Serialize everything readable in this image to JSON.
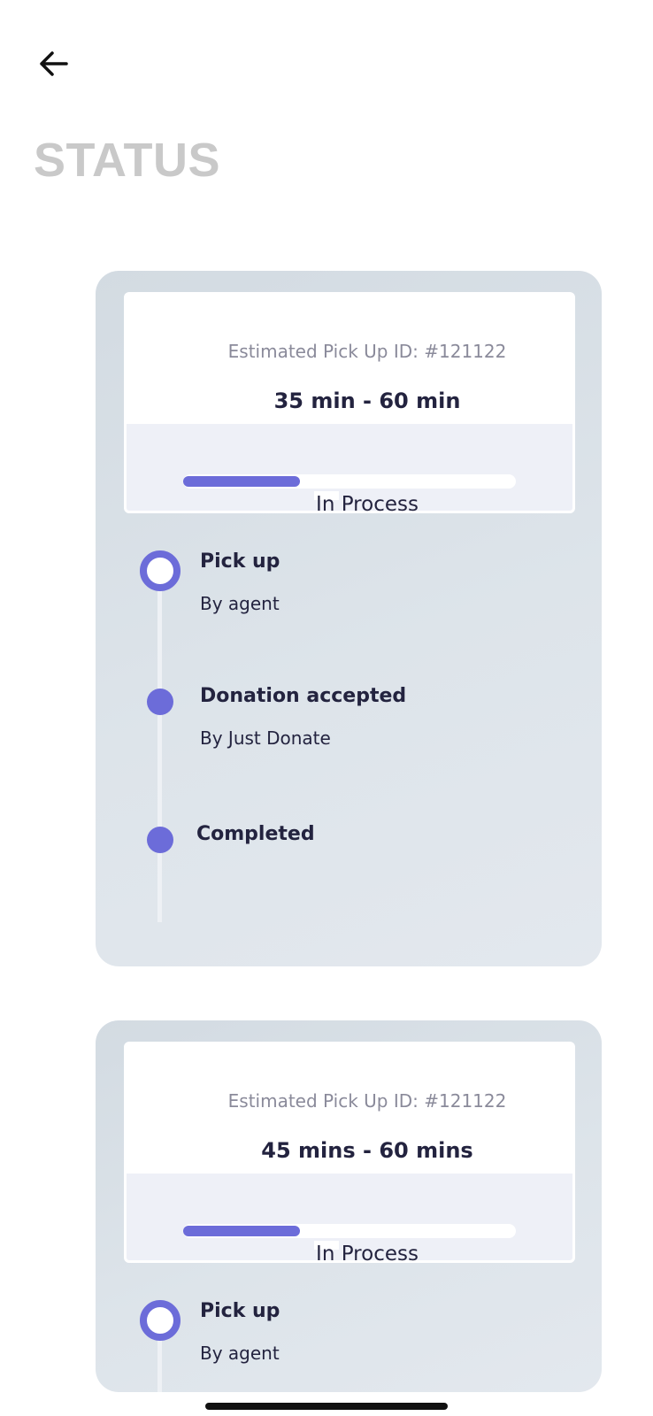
{
  "header": {
    "back_icon": "arrow-left-icon",
    "title": "STATUS"
  },
  "colors": {
    "accent": "#6c6cd9",
    "title_gray": "#c9c9c9",
    "card_bg": "#d9e0e6"
  },
  "orders": [
    {
      "estimate_label": "Estimated Pick Up ID: #121122",
      "estimate_time": "35 min - 60 min",
      "progress": 0.35,
      "status": "In Process",
      "steps": [
        {
          "title": "Pick up",
          "subtitle": "By agent",
          "state": "current"
        },
        {
          "title": "Donation accepted",
          "subtitle": "By Just Donate",
          "state": "pending"
        },
        {
          "title": "Completed",
          "subtitle": "",
          "state": "pending"
        }
      ]
    },
    {
      "estimate_label": "Estimated Pick Up ID: #121122",
      "estimate_time": "45 mins - 60 mins",
      "progress": 0.35,
      "status": "In Process",
      "steps": [
        {
          "title": "Pick up",
          "subtitle": "By agent",
          "state": "current"
        }
      ]
    }
  ]
}
